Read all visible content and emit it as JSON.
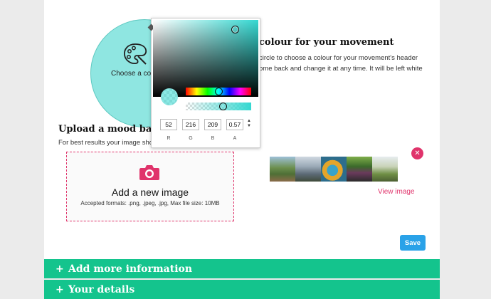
{
  "colour_section": {
    "heading": "colour for your movement",
    "description": "circle to choose a colour for your movement's header ome back and change it at any time. It will be left white",
    "circle_label": "Choose a colo",
    "circle_color": "#8fe6e1"
  },
  "picker": {
    "fields": [
      {
        "label": "R",
        "value": "52"
      },
      {
        "label": "G",
        "value": "216"
      },
      {
        "label": "B",
        "value": "209"
      },
      {
        "label": "A",
        "value": "0.57"
      }
    ],
    "hue_fraction": 0.5,
    "alpha_fraction": 0.57,
    "selected_color": "#34d8d1"
  },
  "upload_section": {
    "heading": "Upload a mood banne",
    "description": "For best results your image sho",
    "dropzone_title": "Add a new image",
    "dropzone_formats": "Accepted formats: .png, .jpeg, .jpg, Max file size: 10MB",
    "remove_icon": "close-icon",
    "view_link": "View image"
  },
  "actions": {
    "save_label": "Save"
  },
  "accordion": [
    {
      "plus": "+",
      "label": "Add more information"
    },
    {
      "plus": "+",
      "label": "Your details"
    }
  ],
  "colors": {
    "accent_pink": "#e0336b",
    "accordion_green": "#14c48d",
    "save_blue": "#2aa2e8"
  }
}
